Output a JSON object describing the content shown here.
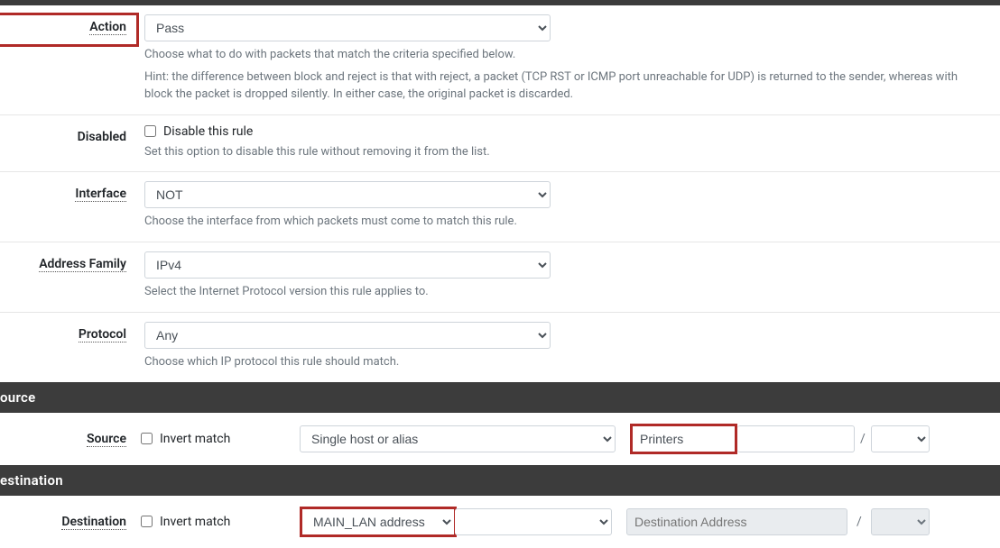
{
  "fields": {
    "action": {
      "label": "Action",
      "value": "Pass",
      "help1": "Choose what to do with packets that match the criteria specified below.",
      "help2": "Hint: the difference between block and reject is that with reject, a packet (TCP RST or ICMP port unreachable for UDP) is returned to the sender, whereas with block the packet is dropped silently. In either case, the original packet is discarded."
    },
    "disabled": {
      "label": "Disabled",
      "checkbox_label": "Disable this rule",
      "help": "Set this option to disable this rule without removing it from the list."
    },
    "interface": {
      "label": "Interface",
      "value": "NOT",
      "help": "Choose the interface from which packets must come to match this rule."
    },
    "address_family": {
      "label": "Address Family",
      "value": "IPv4",
      "help": "Select the Internet Protocol version this rule applies to."
    },
    "protocol": {
      "label": "Protocol",
      "value": "Any",
      "help": "Choose which IP protocol this rule should match."
    }
  },
  "source": {
    "header": "ource",
    "label": "Source",
    "invert_label": "Invert match",
    "type_value": "Single host or alias",
    "addr_value": "Printers",
    "slash": "/"
  },
  "destination": {
    "header": "estination",
    "label": "Destination",
    "invert_label": "Invert match",
    "type_value": "MAIN_LAN address",
    "addr_placeholder": "Destination Address",
    "slash": "/"
  }
}
